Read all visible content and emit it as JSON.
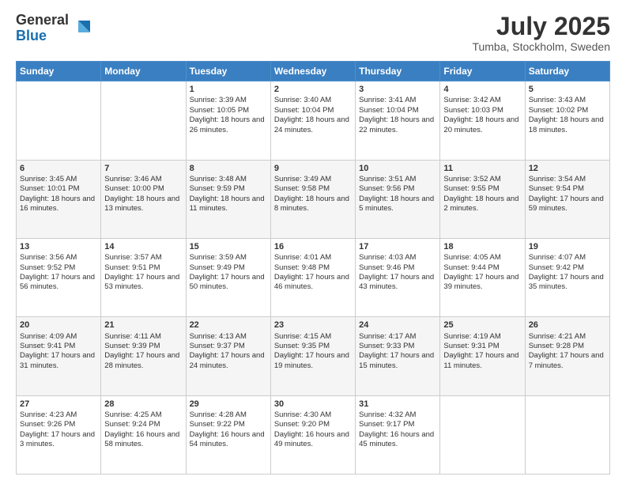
{
  "logo": {
    "general": "General",
    "blue": "Blue"
  },
  "title": "July 2025",
  "location": "Tumba, Stockholm, Sweden",
  "days_of_week": [
    "Sunday",
    "Monday",
    "Tuesday",
    "Wednesday",
    "Thursday",
    "Friday",
    "Saturday"
  ],
  "weeks": [
    [
      {
        "day": "",
        "info": ""
      },
      {
        "day": "",
        "info": ""
      },
      {
        "day": "1",
        "info": "Sunrise: 3:39 AM\nSunset: 10:05 PM\nDaylight: 18 hours and 26 minutes."
      },
      {
        "day": "2",
        "info": "Sunrise: 3:40 AM\nSunset: 10:04 PM\nDaylight: 18 hours and 24 minutes."
      },
      {
        "day": "3",
        "info": "Sunrise: 3:41 AM\nSunset: 10:04 PM\nDaylight: 18 hours and 22 minutes."
      },
      {
        "day": "4",
        "info": "Sunrise: 3:42 AM\nSunset: 10:03 PM\nDaylight: 18 hours and 20 minutes."
      },
      {
        "day": "5",
        "info": "Sunrise: 3:43 AM\nSunset: 10:02 PM\nDaylight: 18 hours and 18 minutes."
      }
    ],
    [
      {
        "day": "6",
        "info": "Sunrise: 3:45 AM\nSunset: 10:01 PM\nDaylight: 18 hours and 16 minutes."
      },
      {
        "day": "7",
        "info": "Sunrise: 3:46 AM\nSunset: 10:00 PM\nDaylight: 18 hours and 13 minutes."
      },
      {
        "day": "8",
        "info": "Sunrise: 3:48 AM\nSunset: 9:59 PM\nDaylight: 18 hours and 11 minutes."
      },
      {
        "day": "9",
        "info": "Sunrise: 3:49 AM\nSunset: 9:58 PM\nDaylight: 18 hours and 8 minutes."
      },
      {
        "day": "10",
        "info": "Sunrise: 3:51 AM\nSunset: 9:56 PM\nDaylight: 18 hours and 5 minutes."
      },
      {
        "day": "11",
        "info": "Sunrise: 3:52 AM\nSunset: 9:55 PM\nDaylight: 18 hours and 2 minutes."
      },
      {
        "day": "12",
        "info": "Sunrise: 3:54 AM\nSunset: 9:54 PM\nDaylight: 17 hours and 59 minutes."
      }
    ],
    [
      {
        "day": "13",
        "info": "Sunrise: 3:56 AM\nSunset: 9:52 PM\nDaylight: 17 hours and 56 minutes."
      },
      {
        "day": "14",
        "info": "Sunrise: 3:57 AM\nSunset: 9:51 PM\nDaylight: 17 hours and 53 minutes."
      },
      {
        "day": "15",
        "info": "Sunrise: 3:59 AM\nSunset: 9:49 PM\nDaylight: 17 hours and 50 minutes."
      },
      {
        "day": "16",
        "info": "Sunrise: 4:01 AM\nSunset: 9:48 PM\nDaylight: 17 hours and 46 minutes."
      },
      {
        "day": "17",
        "info": "Sunrise: 4:03 AM\nSunset: 9:46 PM\nDaylight: 17 hours and 43 minutes."
      },
      {
        "day": "18",
        "info": "Sunrise: 4:05 AM\nSunset: 9:44 PM\nDaylight: 17 hours and 39 minutes."
      },
      {
        "day": "19",
        "info": "Sunrise: 4:07 AM\nSunset: 9:42 PM\nDaylight: 17 hours and 35 minutes."
      }
    ],
    [
      {
        "day": "20",
        "info": "Sunrise: 4:09 AM\nSunset: 9:41 PM\nDaylight: 17 hours and 31 minutes."
      },
      {
        "day": "21",
        "info": "Sunrise: 4:11 AM\nSunset: 9:39 PM\nDaylight: 17 hours and 28 minutes."
      },
      {
        "day": "22",
        "info": "Sunrise: 4:13 AM\nSunset: 9:37 PM\nDaylight: 17 hours and 24 minutes."
      },
      {
        "day": "23",
        "info": "Sunrise: 4:15 AM\nSunset: 9:35 PM\nDaylight: 17 hours and 19 minutes."
      },
      {
        "day": "24",
        "info": "Sunrise: 4:17 AM\nSunset: 9:33 PM\nDaylight: 17 hours and 15 minutes."
      },
      {
        "day": "25",
        "info": "Sunrise: 4:19 AM\nSunset: 9:31 PM\nDaylight: 17 hours and 11 minutes."
      },
      {
        "day": "26",
        "info": "Sunrise: 4:21 AM\nSunset: 9:28 PM\nDaylight: 17 hours and 7 minutes."
      }
    ],
    [
      {
        "day": "27",
        "info": "Sunrise: 4:23 AM\nSunset: 9:26 PM\nDaylight: 17 hours and 3 minutes."
      },
      {
        "day": "28",
        "info": "Sunrise: 4:25 AM\nSunset: 9:24 PM\nDaylight: 16 hours and 58 minutes."
      },
      {
        "day": "29",
        "info": "Sunrise: 4:28 AM\nSunset: 9:22 PM\nDaylight: 16 hours and 54 minutes."
      },
      {
        "day": "30",
        "info": "Sunrise: 4:30 AM\nSunset: 9:20 PM\nDaylight: 16 hours and 49 minutes."
      },
      {
        "day": "31",
        "info": "Sunrise: 4:32 AM\nSunset: 9:17 PM\nDaylight: 16 hours and 45 minutes."
      },
      {
        "day": "",
        "info": ""
      },
      {
        "day": "",
        "info": ""
      }
    ]
  ]
}
